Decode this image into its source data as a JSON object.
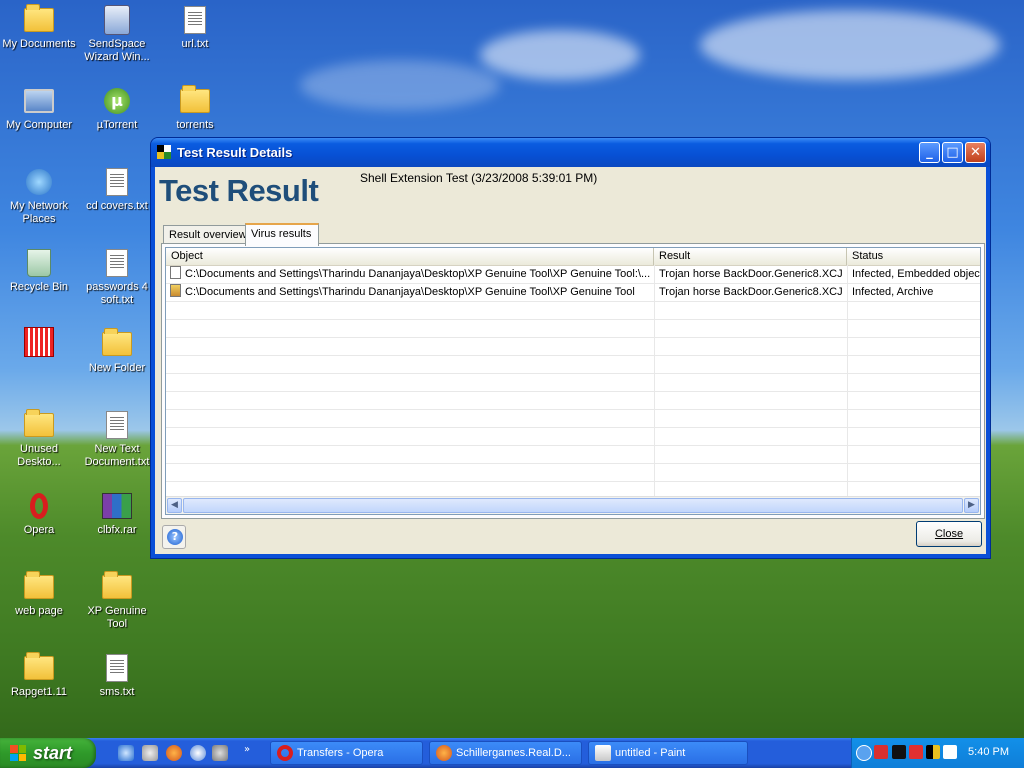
{
  "desktop": {
    "icons": [
      {
        "label": "My Documents"
      },
      {
        "label": "SendSpace Wizard Win..."
      },
      {
        "label": "url.txt"
      },
      {
        "label": "My Computer"
      },
      {
        "label": "µTorrent"
      },
      {
        "label": "torrents"
      },
      {
        "label": "My Network Places"
      },
      {
        "label": "cd covers.txt"
      },
      {
        "label": "Recycle Bin"
      },
      {
        "label": "passwords 4 soft.txt"
      },
      {
        "label": ""
      },
      {
        "label": "New Folder"
      },
      {
        "label": "Unused Deskto..."
      },
      {
        "label": "New Text Document.txt"
      },
      {
        "label": "Opera"
      },
      {
        "label": "clbfx.rar"
      },
      {
        "label": "web page"
      },
      {
        "label": "XP Genuine Tool"
      },
      {
        "label": "Rapget1.11"
      },
      {
        "label": "sms.txt"
      }
    ]
  },
  "window": {
    "title": "Test Result Details",
    "heading": "Test Result",
    "subheading": "Shell Extension Test (3/23/2008 5:39:01 PM)",
    "tabs": [
      {
        "label": "Result overview"
      },
      {
        "label": "Virus results"
      }
    ],
    "active_tab": "Virus results",
    "columns": [
      "Object",
      "Result",
      "Status"
    ],
    "rows": [
      {
        "object": "C:\\Documents and Settings\\Tharindu Dananjaya\\Desktop\\XP Genuine Tool\\XP Genuine Tool:\\...",
        "result": "Trojan horse BackDoor.Generic8.XCJ",
        "status": "Infected, Embedded object"
      },
      {
        "object": "C:\\Documents and Settings\\Tharindu Dananjaya\\Desktop\\XP Genuine Tool\\XP Genuine Tool",
        "result": "Trojan horse BackDoor.Generic8.XCJ",
        "status": "Infected, Archive"
      }
    ],
    "close_label": "Close",
    "help_label": "?"
  },
  "taskbar": {
    "start_label": "start",
    "buttons": [
      {
        "label": "Transfers - Opera"
      },
      {
        "label": "Schillergames.Real.D..."
      },
      {
        "label": "untitled - Paint"
      }
    ],
    "clock": "5:40 PM"
  },
  "colors": {
    "xp_blue": "#0a50d8",
    "heading_blue": "#1f4e7a",
    "start_green": "#3a9e31"
  }
}
